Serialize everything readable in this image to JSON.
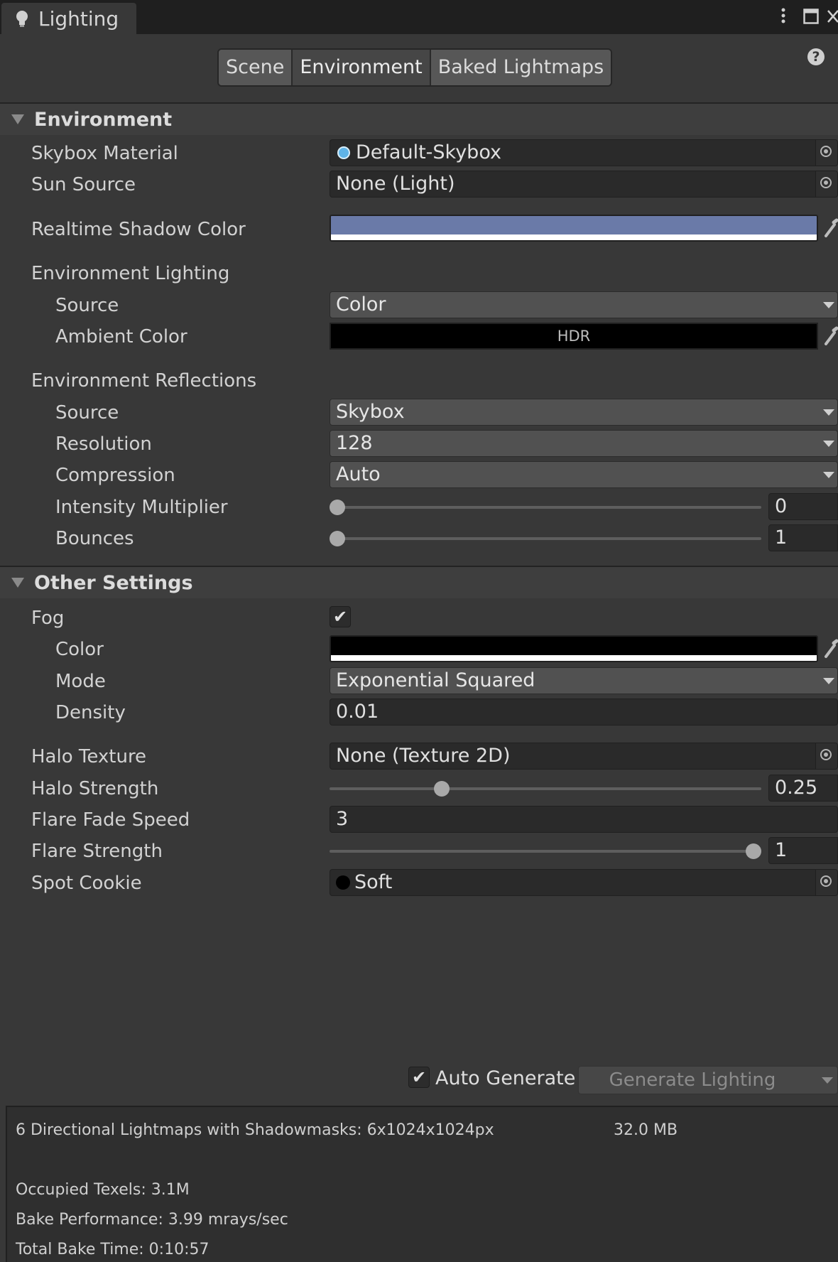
{
  "window": {
    "tab_title": "Lighting",
    "menu_icon": "vertical-ellipsis-icon",
    "maximize_icon": "maximize-icon",
    "close_icon": "close-icon"
  },
  "toolbar": {
    "tabs": [
      "Scene",
      "Environment",
      "Baked Lightmaps"
    ],
    "active_tab": "Environment",
    "help_label": "?"
  },
  "environment": {
    "header": "Environment",
    "skybox_material": {
      "label": "Skybox Material",
      "value": "Default-Skybox"
    },
    "sun_source": {
      "label": "Sun Source",
      "value": "None (Light)"
    },
    "realtime_shadow_color": {
      "label": "Realtime Shadow Color",
      "color": "#6a7aa8"
    },
    "env_lighting": {
      "label": "Environment Lighting",
      "source_label": "Source",
      "source_value": "Color",
      "ambient_label": "Ambient Color",
      "ambient_color": "#000000",
      "ambient_badge": "HDR"
    },
    "env_reflections": {
      "label": "Environment Reflections",
      "source_label": "Source",
      "source_value": "Skybox",
      "resolution_label": "Resolution",
      "resolution_value": "128",
      "compression_label": "Compression",
      "compression_value": "Auto",
      "intensity_label": "Intensity Multiplier",
      "intensity_value": "0",
      "intensity_fraction": 0.0,
      "bounces_label": "Bounces",
      "bounces_value": "1",
      "bounces_fraction": 0.0
    }
  },
  "other": {
    "header": "Other Settings",
    "fog": {
      "label": "Fog",
      "checked": true,
      "check_glyph": "✔"
    },
    "fog_color": {
      "label": "Color",
      "color": "#000000"
    },
    "fog_mode": {
      "label": "Mode",
      "value": "Exponential Squared"
    },
    "fog_density": {
      "label": "Density",
      "value": "0.01"
    },
    "halo_texture": {
      "label": "Halo Texture",
      "value": "None (Texture 2D)"
    },
    "halo_strength": {
      "label": "Halo Strength",
      "value": "0.25",
      "fraction": 0.25
    },
    "flare_fade_speed": {
      "label": "Flare Fade Speed",
      "value": "3"
    },
    "flare_strength": {
      "label": "Flare Strength",
      "value": "1",
      "fraction": 1.0
    },
    "spot_cookie": {
      "label": "Spot Cookie",
      "value": "Soft"
    }
  },
  "bottom": {
    "auto_generate_label": "Auto Generate",
    "auto_generate_checked": true,
    "check_glyph": "✔",
    "generate_button": "Generate Lighting"
  },
  "stats": {
    "lightmaps": "6 Directional Lightmaps with Shadowmasks: 6x1024x1024px",
    "size": "32.0 MB",
    "occupied": "Occupied Texels: 3.1M",
    "performance": "Bake Performance: 3.99 mrays/sec",
    "bake_time": "Total Bake Time: 0:10:57"
  },
  "colors": {
    "panel_bg": "#383838",
    "field_bg": "#2a2a2a",
    "skybox_icon": "#5fb4e8"
  }
}
